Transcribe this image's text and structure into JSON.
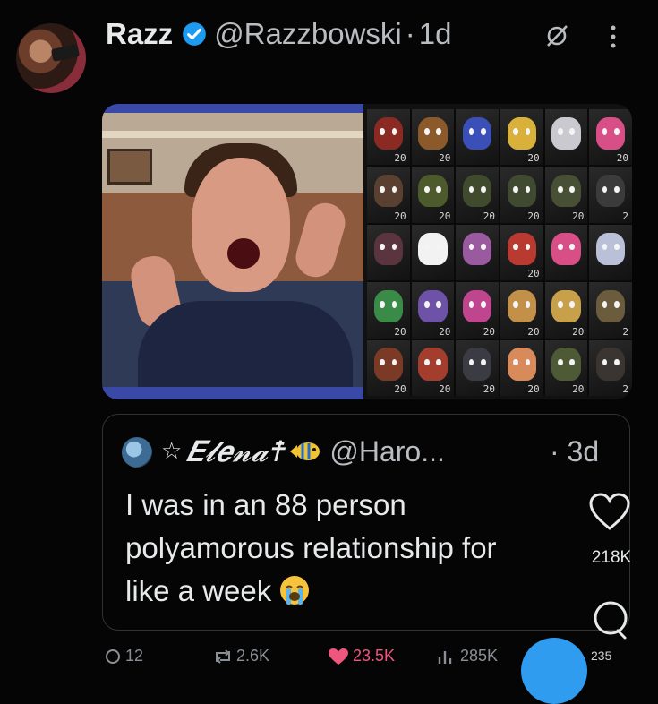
{
  "post": {
    "display_name": "Razz",
    "handle": "@Razzbowski",
    "separator": "·",
    "time": "1d"
  },
  "media": {
    "grid_numbers": [
      "20",
      "20",
      "",
      "20",
      "",
      "20",
      "20",
      "20",
      "20",
      "20",
      "20",
      "2",
      "",
      "",
      "",
      "20",
      "",
      "",
      "20",
      "20",
      "20",
      "20",
      "20",
      "2",
      "20",
      "20",
      "20",
      "20",
      "20",
      "2"
    ],
    "grid_colors": [
      "#8a2a22",
      "#8c5a2a",
      "#3b4fb8",
      "#d9b13a",
      "#c9c9cf",
      "#d84e86",
      "#5a4030",
      "#4d5a2c",
      "#404a2c",
      "#3f4a30",
      "#475035",
      "#3b3b3b",
      "#5a3540",
      "#f2f2f2",
      "#9a5aa0",
      "#b83a30",
      "#d84e86",
      "#b9c0d8",
      "#3a8a48",
      "#6d52a8",
      "#c0458f",
      "#c3904a",
      "#c8a04a",
      "#6a5c3c",
      "#7a3a26",
      "#a33e2e",
      "#3b3b44",
      "#d88a5a",
      "#4e5a36",
      "#3a3530"
    ]
  },
  "quote": {
    "name": "☆𝑬𝓵𝒆𝓷𝓪☨",
    "handle": "@Haro...",
    "time": "· 3d",
    "lines": [
      "I was in an 88 person",
      "polyamorous relationship for",
      "like a week"
    ]
  },
  "side": {
    "like_count": "218K"
  },
  "actions": {
    "replies": "12",
    "retweets": "2.6K",
    "likes": "23.5K",
    "views": "285K",
    "extra": "235"
  },
  "colors": {
    "verified": "#1d9bf0",
    "like": "#f0557e",
    "fab": "#2f9cf0"
  }
}
